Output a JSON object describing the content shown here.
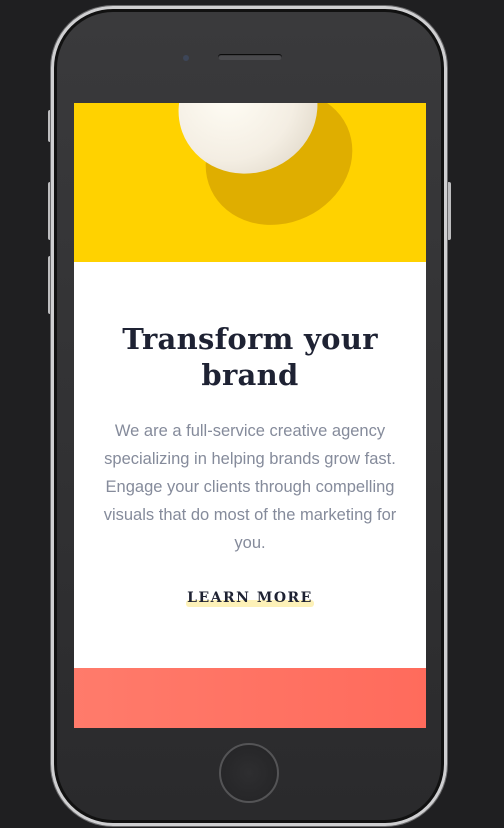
{
  "hero": {
    "background_color": "#ffd200",
    "image": "egg-on-yellow"
  },
  "content": {
    "title": "Transform your brand",
    "body": "We are a full-service creative agency specializing in helping brands grow fast. Engage your clients through compelling visuals that do most of the marketing for you.",
    "cta_label": "LEARN MORE"
  },
  "colors": {
    "title": "#1e2233",
    "body": "#858b9b",
    "cta_highlight": "#fdf1b8",
    "footer_band": "#ff6b5c"
  }
}
